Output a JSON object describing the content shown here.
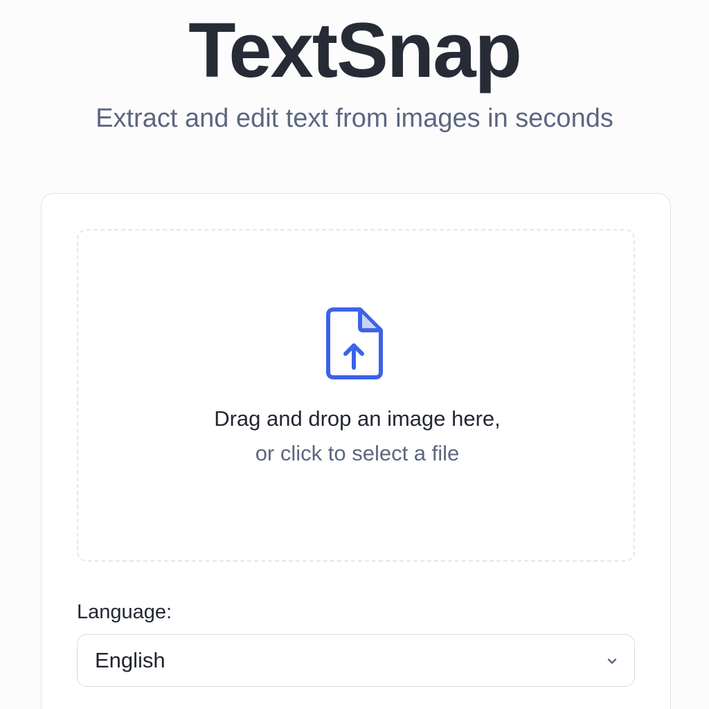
{
  "header": {
    "app_title": "TextSnap",
    "subtitle": "Extract and edit text from images in seconds"
  },
  "upload": {
    "icon": "file-upload-icon",
    "primary_text": "Drag and drop an image here,",
    "secondary_text": "or click to select a file"
  },
  "language": {
    "label": "Language:",
    "selected": "English",
    "dropdown_icon": "chevron-down-icon"
  },
  "colors": {
    "accent": "#3b63e8",
    "title": "#262b36",
    "muted_text": "#5d6680",
    "border": "#dfe2ec"
  }
}
